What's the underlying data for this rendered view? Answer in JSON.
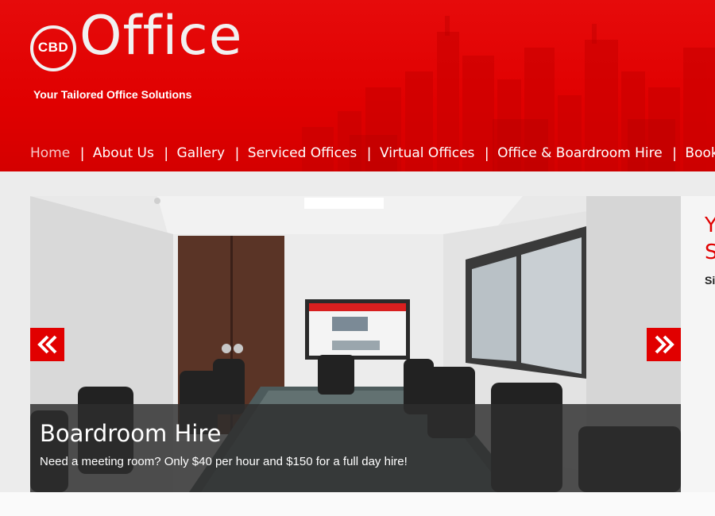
{
  "brand": {
    "logo_badge": "CBD",
    "logo_word": "Office",
    "tagline": "Your Tailored Office Solutions"
  },
  "nav": {
    "items": [
      {
        "label": "Home",
        "active": true
      },
      {
        "label": "About Us"
      },
      {
        "label": "Gallery"
      },
      {
        "label": "Serviced Offices"
      },
      {
        "label": "Virtual Offices"
      },
      {
        "label": "Office & Boardroom Hire"
      },
      {
        "label": "Booking"
      }
    ],
    "separator": "|"
  },
  "slider": {
    "title": "Boardroom Hire",
    "text": "Need a meeting room? Only $40 per hour and $150 for a full day hire!",
    "prev_icon": "double-chevron-left-icon",
    "next_icon": "double-chevron-right-icon"
  },
  "side_panel": {
    "heading_line1": "Y",
    "heading_line2": "S",
    "subheading": "Si"
  },
  "colors": {
    "brand_red": "#e10000",
    "caption_bg": "#2d2d2d",
    "page_bg": "#ececec"
  }
}
